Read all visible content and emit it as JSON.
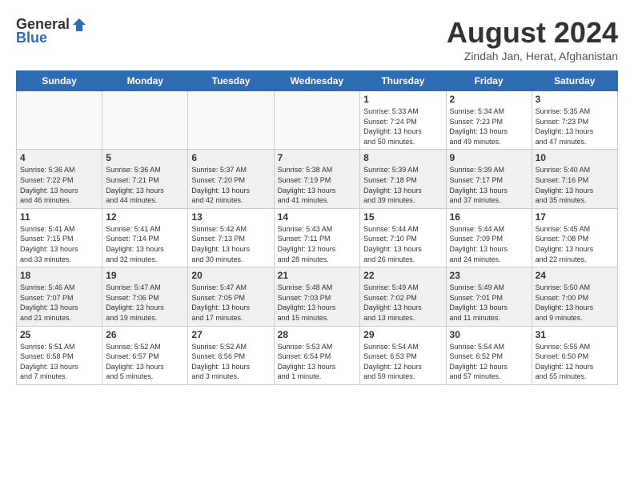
{
  "header": {
    "logo_general": "General",
    "logo_blue": "Blue",
    "month_title": "August 2024",
    "location": "Zindah Jan, Herat, Afghanistan"
  },
  "days_of_week": [
    "Sunday",
    "Monday",
    "Tuesday",
    "Wednesday",
    "Thursday",
    "Friday",
    "Saturday"
  ],
  "weeks": [
    {
      "shaded": false,
      "days": [
        {
          "num": "",
          "info": ""
        },
        {
          "num": "",
          "info": ""
        },
        {
          "num": "",
          "info": ""
        },
        {
          "num": "",
          "info": ""
        },
        {
          "num": "1",
          "info": "Sunrise: 5:33 AM\nSunset: 7:24 PM\nDaylight: 13 hours\nand 50 minutes."
        },
        {
          "num": "2",
          "info": "Sunrise: 5:34 AM\nSunset: 7:23 PM\nDaylight: 13 hours\nand 49 minutes."
        },
        {
          "num": "3",
          "info": "Sunrise: 5:35 AM\nSunset: 7:23 PM\nDaylight: 13 hours\nand 47 minutes."
        }
      ]
    },
    {
      "shaded": true,
      "days": [
        {
          "num": "4",
          "info": "Sunrise: 5:36 AM\nSunset: 7:22 PM\nDaylight: 13 hours\nand 46 minutes."
        },
        {
          "num": "5",
          "info": "Sunrise: 5:36 AM\nSunset: 7:21 PM\nDaylight: 13 hours\nand 44 minutes."
        },
        {
          "num": "6",
          "info": "Sunrise: 5:37 AM\nSunset: 7:20 PM\nDaylight: 13 hours\nand 42 minutes."
        },
        {
          "num": "7",
          "info": "Sunrise: 5:38 AM\nSunset: 7:19 PM\nDaylight: 13 hours\nand 41 minutes."
        },
        {
          "num": "8",
          "info": "Sunrise: 5:39 AM\nSunset: 7:18 PM\nDaylight: 13 hours\nand 39 minutes."
        },
        {
          "num": "9",
          "info": "Sunrise: 5:39 AM\nSunset: 7:17 PM\nDaylight: 13 hours\nand 37 minutes."
        },
        {
          "num": "10",
          "info": "Sunrise: 5:40 AM\nSunset: 7:16 PM\nDaylight: 13 hours\nand 35 minutes."
        }
      ]
    },
    {
      "shaded": false,
      "days": [
        {
          "num": "11",
          "info": "Sunrise: 5:41 AM\nSunset: 7:15 PM\nDaylight: 13 hours\nand 33 minutes."
        },
        {
          "num": "12",
          "info": "Sunrise: 5:41 AM\nSunset: 7:14 PM\nDaylight: 13 hours\nand 32 minutes."
        },
        {
          "num": "13",
          "info": "Sunrise: 5:42 AM\nSunset: 7:13 PM\nDaylight: 13 hours\nand 30 minutes."
        },
        {
          "num": "14",
          "info": "Sunrise: 5:43 AM\nSunset: 7:11 PM\nDaylight: 13 hours\nand 28 minutes."
        },
        {
          "num": "15",
          "info": "Sunrise: 5:44 AM\nSunset: 7:10 PM\nDaylight: 13 hours\nand 26 minutes."
        },
        {
          "num": "16",
          "info": "Sunrise: 5:44 AM\nSunset: 7:09 PM\nDaylight: 13 hours\nand 24 minutes."
        },
        {
          "num": "17",
          "info": "Sunrise: 5:45 AM\nSunset: 7:08 PM\nDaylight: 13 hours\nand 22 minutes."
        }
      ]
    },
    {
      "shaded": true,
      "days": [
        {
          "num": "18",
          "info": "Sunrise: 5:46 AM\nSunset: 7:07 PM\nDaylight: 13 hours\nand 21 minutes."
        },
        {
          "num": "19",
          "info": "Sunrise: 5:47 AM\nSunset: 7:06 PM\nDaylight: 13 hours\nand 19 minutes."
        },
        {
          "num": "20",
          "info": "Sunrise: 5:47 AM\nSunset: 7:05 PM\nDaylight: 13 hours\nand 17 minutes."
        },
        {
          "num": "21",
          "info": "Sunrise: 5:48 AM\nSunset: 7:03 PM\nDaylight: 13 hours\nand 15 minutes."
        },
        {
          "num": "22",
          "info": "Sunrise: 5:49 AM\nSunset: 7:02 PM\nDaylight: 13 hours\nand 13 minutes."
        },
        {
          "num": "23",
          "info": "Sunrise: 5:49 AM\nSunset: 7:01 PM\nDaylight: 13 hours\nand 11 minutes."
        },
        {
          "num": "24",
          "info": "Sunrise: 5:50 AM\nSunset: 7:00 PM\nDaylight: 13 hours\nand 9 minutes."
        }
      ]
    },
    {
      "shaded": false,
      "days": [
        {
          "num": "25",
          "info": "Sunrise: 5:51 AM\nSunset: 6:58 PM\nDaylight: 13 hours\nand 7 minutes."
        },
        {
          "num": "26",
          "info": "Sunrise: 5:52 AM\nSunset: 6:57 PM\nDaylight: 13 hours\nand 5 minutes."
        },
        {
          "num": "27",
          "info": "Sunrise: 5:52 AM\nSunset: 6:56 PM\nDaylight: 13 hours\nand 3 minutes."
        },
        {
          "num": "28",
          "info": "Sunrise: 5:53 AM\nSunset: 6:54 PM\nDaylight: 13 hours\nand 1 minute."
        },
        {
          "num": "29",
          "info": "Sunrise: 5:54 AM\nSunset: 6:53 PM\nDaylight: 12 hours\nand 59 minutes."
        },
        {
          "num": "30",
          "info": "Sunrise: 5:54 AM\nSunset: 6:52 PM\nDaylight: 12 hours\nand 57 minutes."
        },
        {
          "num": "31",
          "info": "Sunrise: 5:55 AM\nSunset: 6:50 PM\nDaylight: 12 hours\nand 55 minutes."
        }
      ]
    }
  ]
}
